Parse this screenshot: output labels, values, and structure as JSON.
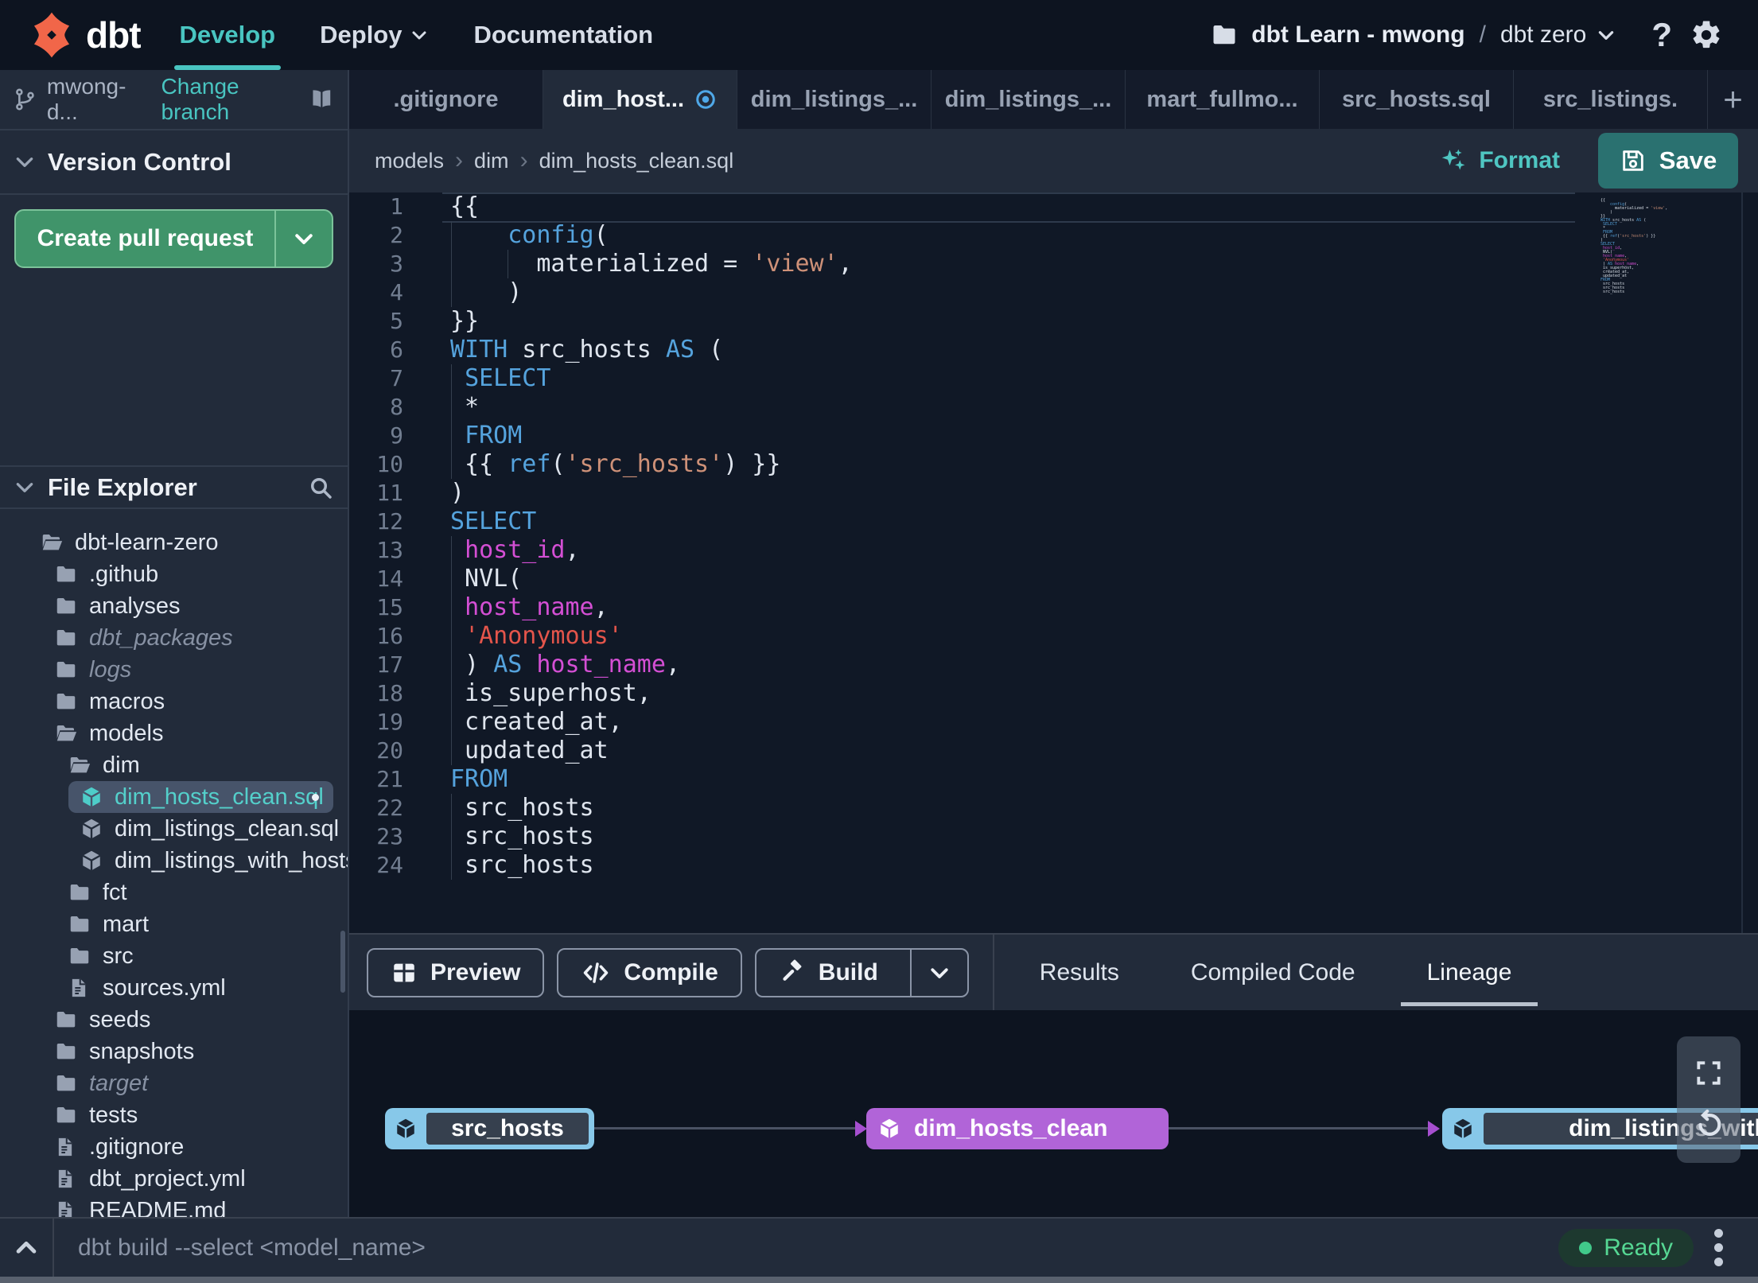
{
  "colors": {
    "accent_teal": "#49c5c1",
    "green_button": "#40946a",
    "save_teal": "#2a7170",
    "node_blue": "#87c8e9",
    "node_purple": "#b164d8",
    "ready_green": "#56d894",
    "code_keyword": "#55a3dd",
    "code_string": "#ce9178",
    "code_string_red": "#e4554b",
    "code_identifier": "#d44fd4"
  },
  "topnav": {
    "logo_text": "dbt",
    "nav": [
      {
        "label": "Develop",
        "active": true
      },
      {
        "label": "Deploy",
        "chevron": true
      },
      {
        "label": "Documentation"
      }
    ],
    "project": {
      "name": "dbt Learn - mwong",
      "separator": "/",
      "environment": "dbt zero"
    },
    "help_label": "?"
  },
  "sidebar": {
    "branch": {
      "name": "mwong-d...",
      "change_label": "Change branch"
    },
    "version_control": {
      "title": "Version Control",
      "create_pr_label": "Create pull request"
    },
    "file_explorer": {
      "title": "File Explorer",
      "tree": [
        {
          "label": "dbt-learn-zero",
          "icon": "folder-open",
          "level": 0
        },
        {
          "label": ".github",
          "icon": "folder",
          "level": 1
        },
        {
          "label": "analyses",
          "icon": "folder",
          "level": 1
        },
        {
          "label": "dbt_packages",
          "icon": "folder",
          "level": 1,
          "muted": true
        },
        {
          "label": "logs",
          "icon": "folder",
          "level": 1,
          "muted": true
        },
        {
          "label": "macros",
          "icon": "folder",
          "level": 1
        },
        {
          "label": "models",
          "icon": "folder-open",
          "level": 1
        },
        {
          "label": "dim",
          "icon": "folder-open",
          "level": 2
        },
        {
          "label": "dim_hosts_clean.sql",
          "icon": "model",
          "level": 3,
          "selected": true,
          "modified": true
        },
        {
          "label": "dim_listings_clean.sql",
          "icon": "model",
          "level": 3
        },
        {
          "label": "dim_listings_with_hosts...",
          "icon": "model",
          "level": 3
        },
        {
          "label": "fct",
          "icon": "folder",
          "level": 2
        },
        {
          "label": "mart",
          "icon": "folder",
          "level": 2
        },
        {
          "label": "src",
          "icon": "folder",
          "level": 2
        },
        {
          "label": "sources.yml",
          "icon": "file",
          "level": 2
        },
        {
          "label": "seeds",
          "icon": "folder",
          "level": 1
        },
        {
          "label": "snapshots",
          "icon": "folder",
          "level": 1
        },
        {
          "label": "target",
          "icon": "folder",
          "level": 1,
          "muted": true
        },
        {
          "label": "tests",
          "icon": "folder",
          "level": 1
        },
        {
          "label": ".gitignore",
          "icon": "file",
          "level": 1
        },
        {
          "label": "dbt_project.yml",
          "icon": "file",
          "level": 1
        },
        {
          "label": "README.md",
          "icon": "file",
          "level": 1
        }
      ]
    }
  },
  "tabbar": {
    "tabs": [
      {
        "label": ".gitignore"
      },
      {
        "label": "dim_host...",
        "active": true,
        "modified": true
      },
      {
        "label": "dim_listings_..."
      },
      {
        "label": "dim_listings_..."
      },
      {
        "label": "mart_fullmo..."
      },
      {
        "label": "src_hosts.sql"
      },
      {
        "label": "src_listings."
      }
    ],
    "add_label": "+"
  },
  "editor": {
    "breadcrumb": [
      "models",
      "dim",
      "dim_hosts_clean.sql"
    ],
    "format_label": "Format",
    "save_label": "Save",
    "code_lines": [
      {
        "n": 1,
        "current": true,
        "tokens": [
          [
            "pl",
            "{{"
          ]
        ]
      },
      {
        "n": 2,
        "tokens": [
          [
            "pl",
            "    "
          ],
          [
            "kw",
            "config"
          ],
          [
            "pl",
            "("
          ]
        ]
      },
      {
        "n": 3,
        "tokens": [
          [
            "pl",
            "      materialized = "
          ],
          [
            "str",
            "'view'"
          ],
          [
            "pl",
            ","
          ]
        ]
      },
      {
        "n": 4,
        "tokens": [
          [
            "pl",
            "    )"
          ]
        ]
      },
      {
        "n": 5,
        "tokens": [
          [
            "pl",
            "}}"
          ]
        ]
      },
      {
        "n": 6,
        "tokens": [
          [
            "kw",
            "WITH"
          ],
          [
            "pl",
            " src_hosts "
          ],
          [
            "kw",
            "AS"
          ],
          [
            "pl",
            " ("
          ]
        ]
      },
      {
        "n": 7,
        "tokens": [
          [
            "pl",
            " "
          ],
          [
            "kw",
            "SELECT"
          ]
        ]
      },
      {
        "n": 8,
        "tokens": [
          [
            "pl",
            " *"
          ]
        ]
      },
      {
        "n": 9,
        "tokens": [
          [
            "pl",
            " "
          ],
          [
            "kw",
            "FROM"
          ]
        ]
      },
      {
        "n": 10,
        "tokens": [
          [
            "pl",
            " {{ "
          ],
          [
            "kw",
            "ref"
          ],
          [
            "pl",
            "("
          ],
          [
            "str",
            "'src_hosts'"
          ],
          [
            "pl",
            ") }}"
          ]
        ]
      },
      {
        "n": 11,
        "tokens": [
          [
            "pl",
            ")"
          ]
        ]
      },
      {
        "n": 12,
        "tokens": [
          [
            "kw",
            "SELECT"
          ]
        ]
      },
      {
        "n": 13,
        "tokens": [
          [
            "pl",
            " "
          ],
          [
            "id",
            "host_id"
          ],
          [
            "pl",
            ","
          ]
        ]
      },
      {
        "n": 14,
        "tokens": [
          [
            "pl",
            " NVL("
          ]
        ]
      },
      {
        "n": 15,
        "tokens": [
          [
            "pl",
            " "
          ],
          [
            "id",
            "host_name"
          ],
          [
            "pl",
            ","
          ]
        ]
      },
      {
        "n": 16,
        "tokens": [
          [
            "pl",
            " "
          ],
          [
            "red",
            "'Anonymous'"
          ]
        ]
      },
      {
        "n": 17,
        "tokens": [
          [
            "pl",
            " ) "
          ],
          [
            "kw",
            "AS"
          ],
          [
            "pl",
            " "
          ],
          [
            "id",
            "host_name"
          ],
          [
            "pl",
            ","
          ]
        ]
      },
      {
        "n": 18,
        "tokens": [
          [
            "pl",
            " is_superhost,"
          ]
        ]
      },
      {
        "n": 19,
        "tokens": [
          [
            "pl",
            " created_at,"
          ]
        ]
      },
      {
        "n": 20,
        "tokens": [
          [
            "pl",
            " updated_at"
          ]
        ]
      },
      {
        "n": 21,
        "tokens": [
          [
            "kw",
            "FROM"
          ]
        ]
      },
      {
        "n": 22,
        "tokens": [
          [
            "pl",
            " src_hosts"
          ]
        ]
      },
      {
        "n": 23,
        "tokens": [
          [
            "pl",
            " src_hosts"
          ]
        ]
      },
      {
        "n": 24,
        "tokens": [
          [
            "pl",
            " src_hosts"
          ]
        ]
      }
    ]
  },
  "bottom_panel": {
    "actions": [
      {
        "label": "Preview",
        "icon": "grid"
      },
      {
        "label": "Compile",
        "icon": "code"
      },
      {
        "label": "Build",
        "icon": "hammer",
        "split": true
      }
    ],
    "tabs": [
      {
        "label": "Results"
      },
      {
        "label": "Compiled Code"
      },
      {
        "label": "Lineage",
        "active": true
      }
    ]
  },
  "lineage": {
    "nodes": [
      {
        "label": "src_hosts",
        "style": "source"
      },
      {
        "label": "dim_hosts_clean",
        "style": "selected"
      },
      {
        "label": "dim_listings_with_h",
        "style": "source"
      }
    ]
  },
  "statusbar": {
    "command_placeholder": "dbt build --select <model_name>",
    "status_label": "Ready"
  }
}
